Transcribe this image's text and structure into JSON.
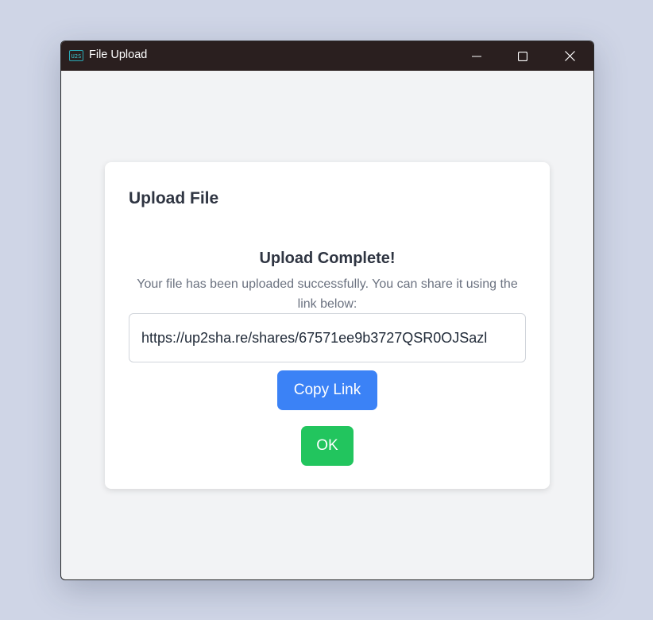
{
  "window": {
    "title": "File Upload",
    "app_icon_text": "U2S",
    "controls": {
      "minimize_icon": "minimize-icon",
      "maximize_icon": "maximize-icon",
      "close_icon": "close-icon"
    }
  },
  "dialog": {
    "title": "Upload File",
    "heading": "Upload Complete!",
    "message": "Your file has been uploaded successfully. You can share it using the link below:",
    "share_link": "https://up2sha.re/shares/67571ee9b3727QSR0OJSazl",
    "copy_button_label": "Copy Link",
    "ok_button_label": "OK"
  },
  "colors": {
    "titlebar": "#2a1f1f",
    "copy_button": "#3b82f6",
    "ok_button": "#22c55e",
    "background": "#cfd5e6"
  }
}
